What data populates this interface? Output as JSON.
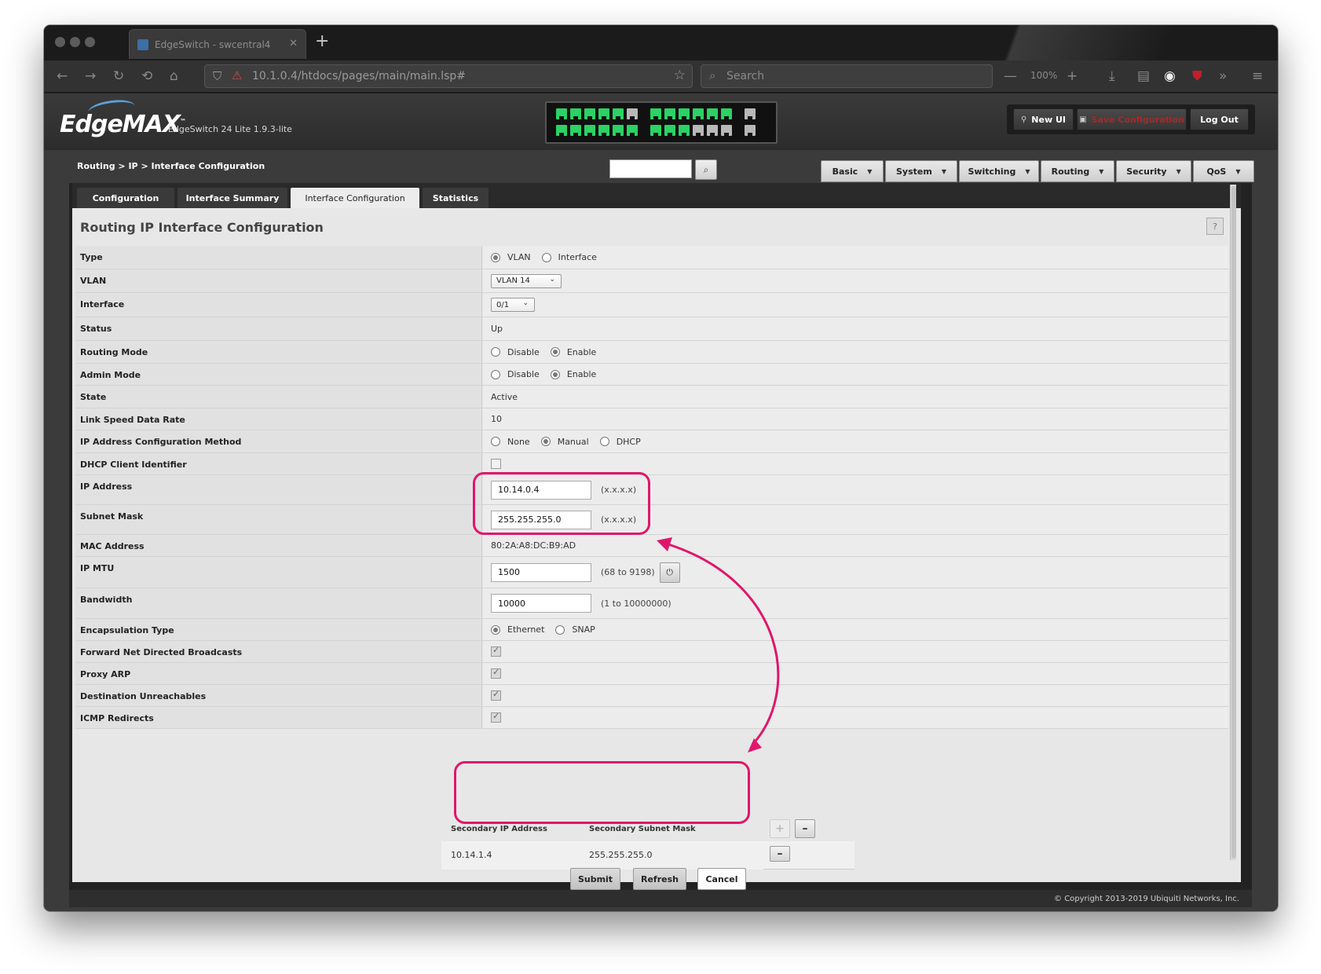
{
  "browser": {
    "tab_title": "EdgeSwitch - swcentral4",
    "url": "10.1.0.4/htdocs/pages/main/main.lsp#",
    "search_placeholder": "Search",
    "zoom": "100%"
  },
  "header": {
    "logo": "EdgeMAX",
    "logo_tm": "™",
    "product": "EdgeSwitch 24 Lite 1.9.3-lite",
    "buttons": {
      "new_ui": "New UI",
      "save_config": "Save Configuration",
      "logout": "Log Out"
    },
    "ports": {
      "top": [
        "up",
        "up",
        "up",
        "up",
        "up",
        "down",
        "up",
        "up",
        "up",
        "up",
        "up",
        "up",
        "down"
      ],
      "bottom": [
        "up",
        "up",
        "up",
        "up",
        "up",
        "up",
        "up",
        "up",
        "up",
        "down",
        "down",
        "down",
        "down"
      ]
    }
  },
  "breadcrumb": "Routing > IP > Interface Configuration",
  "mainnav": [
    "Basic",
    "System",
    "Switching",
    "Routing",
    "Security",
    "QoS"
  ],
  "subtabs": [
    "Configuration",
    "Interface Summary",
    "Interface Configuration",
    "Statistics"
  ],
  "page_title": "Routing IP Interface Configuration",
  "help": "?",
  "form": {
    "type_label": "Type",
    "type_opts": [
      "VLAN",
      "Interface"
    ],
    "vlan_label": "VLAN",
    "vlan_value": "VLAN 14",
    "interface_label": "Interface",
    "interface_value": "0/1",
    "status_label": "Status",
    "status_value": "Up",
    "routing_mode_label": "Routing Mode",
    "admin_mode_label": "Admin Mode",
    "mode_opts": [
      "Disable",
      "Enable"
    ],
    "state_label": "State",
    "state_value": "Active",
    "link_speed_label": "Link Speed Data Rate",
    "link_speed_value": "10",
    "ip_method_label": "IP Address Configuration Method",
    "ip_method_opts": [
      "None",
      "Manual",
      "DHCP"
    ],
    "dhcp_client_label": "DHCP Client Identifier",
    "ip_label": "IP Address",
    "ip_value": "10.14.0.4",
    "ip_hint": "(x.x.x.x)",
    "mask_label": "Subnet Mask",
    "mask_value": "255.255.255.0",
    "mask_hint": "(x.x.x.x)",
    "mac_label": "MAC Address",
    "mac_value": "80:2A:A8:DC:B9:AD",
    "mtu_label": "IP MTU",
    "mtu_value": "1500",
    "mtu_hint": "(68 to 9198)",
    "bw_label": "Bandwidth",
    "bw_value": "10000",
    "bw_hint": "(1 to 10000000)",
    "encap_label": "Encapsulation Type",
    "encap_opts": [
      "Ethernet",
      "SNAP"
    ],
    "fwd_label": "Forward Net Directed Broadcasts",
    "proxy_label": "Proxy ARP",
    "dest_label": "Destination Unreachables",
    "icmp_label": "ICMP Redirects"
  },
  "secondary": {
    "col1": "Secondary IP Address",
    "col2": "Secondary Subnet Mask",
    "ip": "10.14.1.4",
    "mask": "255.255.255.0"
  },
  "actions": {
    "submit": "Submit",
    "refresh": "Refresh",
    "cancel": "Cancel"
  },
  "footer": "© Copyright 2013-2019 Ubiquiti Networks, Inc.",
  "colors": {
    "highlight": "#e0166c",
    "port_up": "#2bd264",
    "port_down": "#b8b8b8"
  },
  "icons": [
    "back-icon",
    "forward-icon",
    "reload-icon",
    "history-icon",
    "home-icon",
    "shield-icon",
    "lock-icon",
    "star-icon",
    "search-icon",
    "download-icon",
    "library-icon",
    "extension-icon",
    "ublock-icon",
    "overflow-icon",
    "menu-icon",
    "power-icon",
    "help-icon"
  ]
}
